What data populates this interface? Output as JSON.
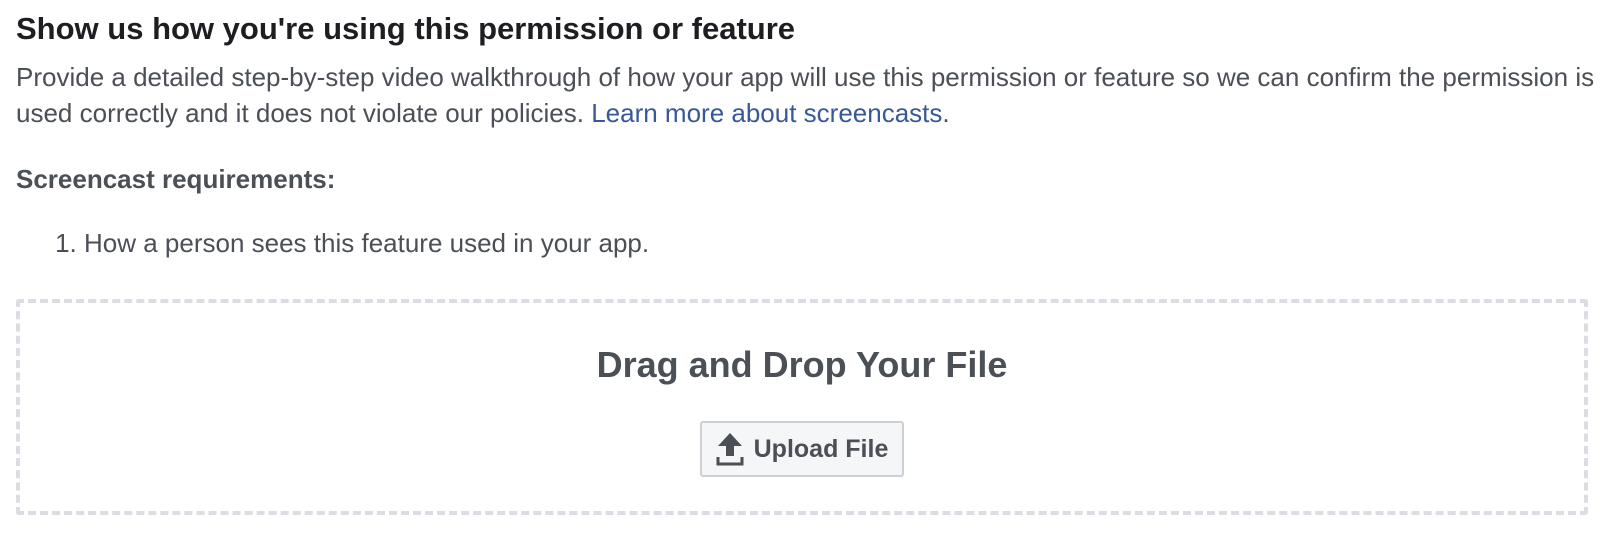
{
  "section": {
    "title": "Show us how you're using this permission or feature",
    "description": "Provide a detailed step-by-step video walkthrough of how your app will use this permission or feature so we can confirm the permission is used correctly and it does not violate our policies. ",
    "learn_more_link": "Learn more about screencasts",
    "description_end": "."
  },
  "requirements": {
    "heading": "Screencast requirements:",
    "items": [
      "How a person sees this feature used in your app."
    ]
  },
  "dropzone": {
    "title": "Drag and Drop Your File",
    "upload_button_label": "Upload File",
    "upload_icon": "upload-icon"
  },
  "colors": {
    "link": "#385898",
    "text": "#4b4f56",
    "border": "#dadde1"
  }
}
